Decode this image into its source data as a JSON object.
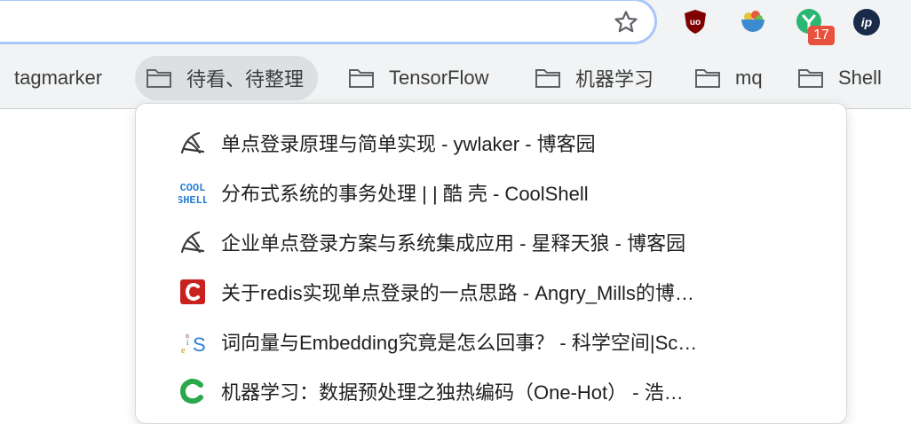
{
  "toolbar": {
    "star_icon": "bookmark-star-icon",
    "extensions": [
      {
        "name": "ublock-origin-icon",
        "label": "uo",
        "color": "#800000"
      },
      {
        "name": "salad-bowl-icon",
        "color": "#3c8bd0"
      },
      {
        "name": "y-extension-icon",
        "color": "#2bb673",
        "badge": "17"
      },
      {
        "name": "ip-extension-icon",
        "label": "ip",
        "color": "#1a2b4a"
      }
    ]
  },
  "bookmarks_bar": {
    "items": [
      {
        "label": "tagmarker",
        "type": "link"
      },
      {
        "label": "待看、待整理",
        "type": "folder",
        "active": true
      },
      {
        "label": "TensorFlow",
        "type": "folder"
      },
      {
        "label": "机器学习",
        "type": "folder"
      },
      {
        "label": "mq",
        "type": "folder"
      },
      {
        "label": "Shell",
        "type": "folder"
      }
    ]
  },
  "menu": {
    "items": [
      {
        "title": "单点登录原理与简单实现 - ywlaker - 博客园",
        "icon": "cnblogs-icon"
      },
      {
        "title": "分布式系统的事务处理 | | 酷 壳 - CoolShell",
        "icon": "coolshell-icon"
      },
      {
        "title": "企业单点登录方案与系统集成应用 - 星释天狼 - 博客园",
        "icon": "cnblogs-icon"
      },
      {
        "title": "关于redis实现单点登录的一点思路 - Angry_Mills的博…",
        "icon": "csdn-icon"
      },
      {
        "title": "词向量与Embedding究竟是怎么回事？ - 科学空间|Sc…",
        "icon": "kexue-icon"
      },
      {
        "title": "机器学习：数据预处理之独热编码（One-Hot） - 浩…",
        "icon": "green-c-icon"
      }
    ]
  },
  "colors": {
    "toolbar_bg": "#f1f3f4",
    "omnibox_focus": "#a8c7fa",
    "badge": "#e9513f",
    "csdn_red": "#c9211e",
    "coolshell_blue": "#2a7fd4",
    "green_c": "#2aa84a"
  }
}
